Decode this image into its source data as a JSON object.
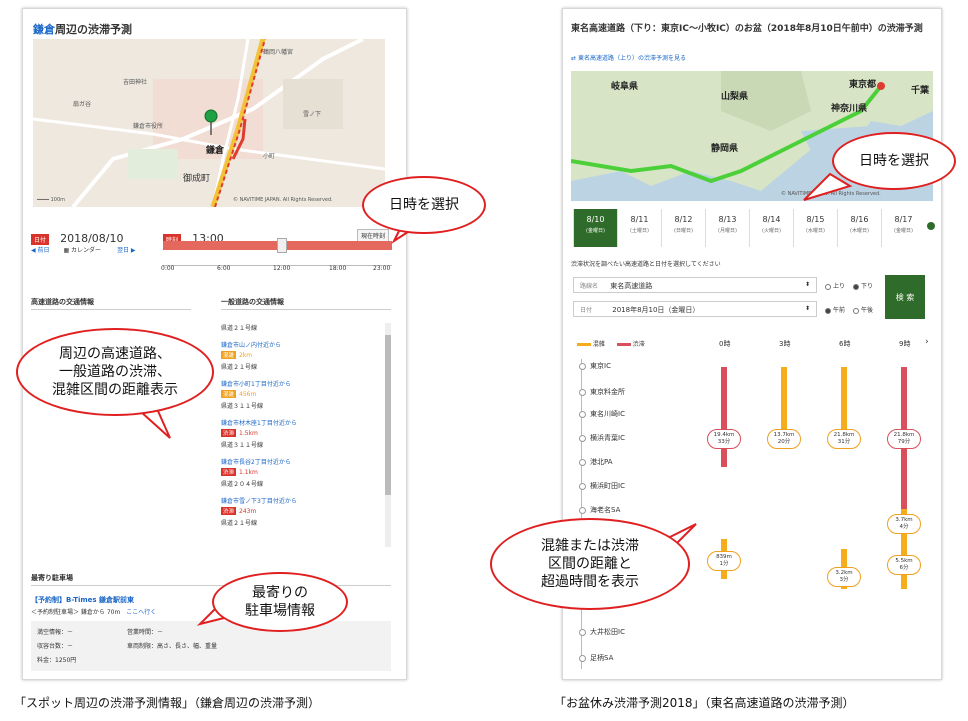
{
  "left": {
    "title_accent": "鎌倉",
    "title_rest": "周辺の渋滞予測",
    "map_labels": [
      "鶴岡八幡宮",
      "吉田神社",
      "鎌倉市役所",
      "御成町",
      "鎌倉",
      "小町",
      "雪ノ下",
      "扇ガ谷"
    ],
    "map_copyright": "© NAVITIME JAPAN. All Rights Reserved.",
    "date_tag": "日付",
    "date_value": "2018/08/10",
    "prev_day": "前日",
    "calendar": "カレンダー",
    "next_day": "翌日",
    "time_tag": "時刻",
    "time_value": "13:00",
    "now_button": "現在時刻",
    "time_ticks": [
      "0:00",
      "6:00",
      "12:00",
      "18:00",
      "23:00"
    ],
    "highway_header": "高速道路の交通情報",
    "general_header": "一般道路の交通情報",
    "general_rows": [
      {
        "road": "県道２１号線"
      },
      {
        "road": "鎌倉市山ノ内付近から",
        "type": "混雑",
        "dist": "2km"
      },
      {
        "road": "県道２１号線"
      },
      {
        "road": "鎌倉市小町1丁目付近から",
        "type": "混雑",
        "dist": "456m"
      },
      {
        "road": "県道３１１号線"
      },
      {
        "road": "鎌倉市材木座1丁目付近から",
        "type": "渋滞",
        "dist": "1.5km"
      },
      {
        "road": "県道３１１号線"
      },
      {
        "road": "鎌倉市長谷2丁目付近から",
        "type": "渋滞",
        "dist": "1.1km"
      },
      {
        "road": "県道２０４号線"
      },
      {
        "road": "鎌倉市雪ノ下3丁目付近から",
        "type": "渋滞",
        "dist": "243m"
      },
      {
        "road": "県道２１号線"
      }
    ],
    "parking_header": "最寄り駐車場",
    "parking_name": "【予約制】B-Times 鎌倉駅前東",
    "parking_sub": "＜予約制駐車場＞ 鎌倉から 70m",
    "parking_more": "ここへ行く",
    "parking_info": [
      "満空情報：－",
      "収容台数：－",
      "料金：1250円",
      "営業時間：－",
      "車両制限：高さ、長さ、幅、重量"
    ]
  },
  "right": {
    "title": "東名高速道路（下り：東京IC〜小牧IC）のお盆（2018年8月10日午前中）の渋滞予測",
    "link": "東名高速道路（上り）の渋滞予測を見る",
    "map_labels": [
      "岐阜県",
      "山梨県",
      "東京都",
      "神奈川県",
      "静岡県",
      "千葉"
    ],
    "dates": [
      {
        "d": "8/10",
        "w": "(金曜日)"
      },
      {
        "d": "8/11",
        "w": "(土曜日)"
      },
      {
        "d": "8/12",
        "w": "(日曜日)"
      },
      {
        "d": "8/13",
        "w": "(月曜日)"
      },
      {
        "d": "8/14",
        "w": "(火曜日)"
      },
      {
        "d": "8/15",
        "w": "(水曜日)"
      },
      {
        "d": "8/16",
        "w": "(木曜日)"
      },
      {
        "d": "8/17",
        "w": "(金曜日)"
      }
    ],
    "form_hint": "渋滞状況を調べたい高速道路と日付を選択してください",
    "road_label": "路線名",
    "road_value": "東名高速道路",
    "date_label": "日付",
    "date_value": "2018年8月10日（金曜日）",
    "dir_up": "上り",
    "dir_down": "下り",
    "am": "午前",
    "pm": "午後",
    "search": "検 索",
    "legend_crowd": "混雑",
    "legend_jam": "渋滞",
    "hours": [
      "0時",
      "3時",
      "6時",
      "9時"
    ],
    "stations": [
      "東京IC",
      "東京料金所",
      "東名川崎IC",
      "横浜青葉IC",
      "港北PA",
      "横浜町田IC",
      "海老名SA",
      "",
      "",
      "",
      "",
      "大井松田IC",
      "足柄SA"
    ],
    "pills": [
      {
        "a": "19.4km",
        "b": "33分"
      },
      {
        "a": "13.7km",
        "b": "20分"
      },
      {
        "a": "21.8km",
        "b": "31分"
      },
      {
        "a": "21.8km",
        "b": "79分"
      },
      {
        "a": "3.7km",
        "b": "4分"
      },
      {
        "a": "839m",
        "b": "1分"
      },
      {
        "a": "3.2km",
        "b": "3分"
      },
      {
        "a": "5.5km",
        "b": "6分"
      }
    ]
  },
  "callouts": {
    "date_select_left": "日時を選択",
    "date_select_right": "日時を選択",
    "roads_l1": "周辺の高速道路、",
    "roads_l2": "一般道路の渋滞、",
    "roads_l3": "混雑区間の距離表示",
    "parking_l1": "最寄りの",
    "parking_l2": "駐車場情報",
    "jam_l1": "混雑または渋滞",
    "jam_l2": "区間の距離と",
    "jam_l3": "超過時間を表示"
  },
  "captions": {
    "left": "「スポット周辺の渋滞予測情報」（鎌倉周辺の渋滞予測）",
    "right": "「お盆休み渋滞予測2018」（東名高速道路の渋滞予測）"
  },
  "colors": {
    "jam": "#d94f5c",
    "crowd": "#f5ad1e",
    "route": "#4cd03a",
    "active_tab": "#2f6b2a",
    "callout_border": "#e02020"
  }
}
